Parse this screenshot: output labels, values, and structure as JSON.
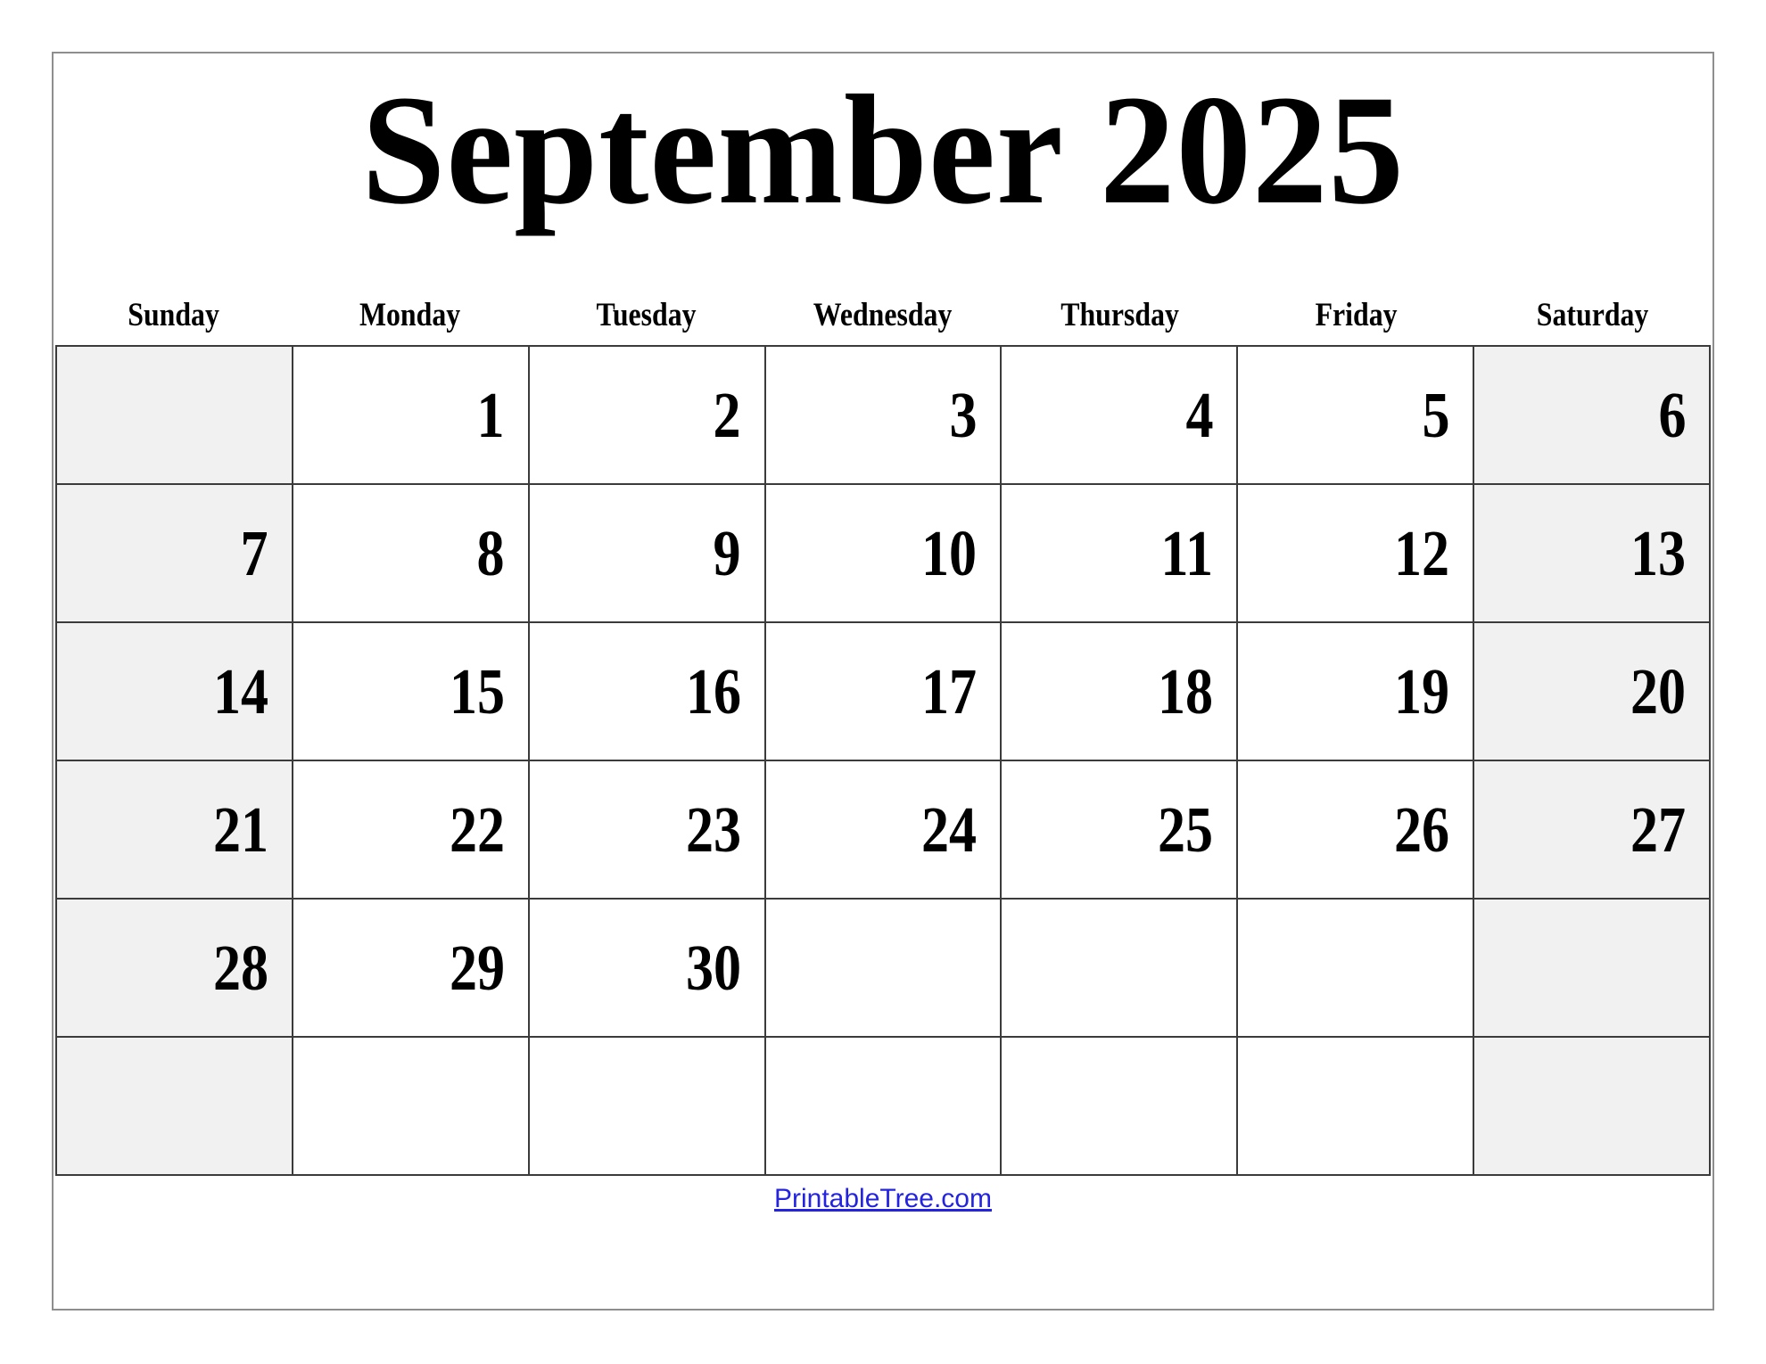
{
  "page": {
    "title": "September 2025",
    "month_name": "September",
    "year": "2025",
    "border_color": "#8e8e8e",
    "background_color": "#ffffff"
  },
  "weekday_headers": [
    {
      "label": "Sunday",
      "weekend": true
    },
    {
      "label": "Monday",
      "weekend": false
    },
    {
      "label": "Tuesday",
      "weekend": false
    },
    {
      "label": "Wednesday",
      "weekend": false
    },
    {
      "label": "Thursday",
      "weekend": false
    },
    {
      "label": "Friday",
      "weekend": false
    },
    {
      "label": "Saturday",
      "weekend": true
    }
  ],
  "colors": {
    "weekend_cell": "#f1f1f1",
    "weekday_cell": "#ffffff",
    "grid_line": "#3b3b3b",
    "text": "#000000",
    "link": "#2323e0"
  },
  "weeks": [
    [
      "",
      "1",
      "2",
      "3",
      "4",
      "5",
      "6"
    ],
    [
      "7",
      "8",
      "9",
      "10",
      "11",
      "12",
      "13"
    ],
    [
      "14",
      "15",
      "16",
      "17",
      "18",
      "19",
      "20"
    ],
    [
      "21",
      "22",
      "23",
      "24",
      "25",
      "26",
      "27"
    ],
    [
      "28",
      "29",
      "30",
      "",
      "",
      "",
      ""
    ],
    [
      "",
      "",
      "",
      "",
      "",
      "",
      ""
    ]
  ],
  "footer": {
    "link_text": "PrintableTree.com"
  }
}
